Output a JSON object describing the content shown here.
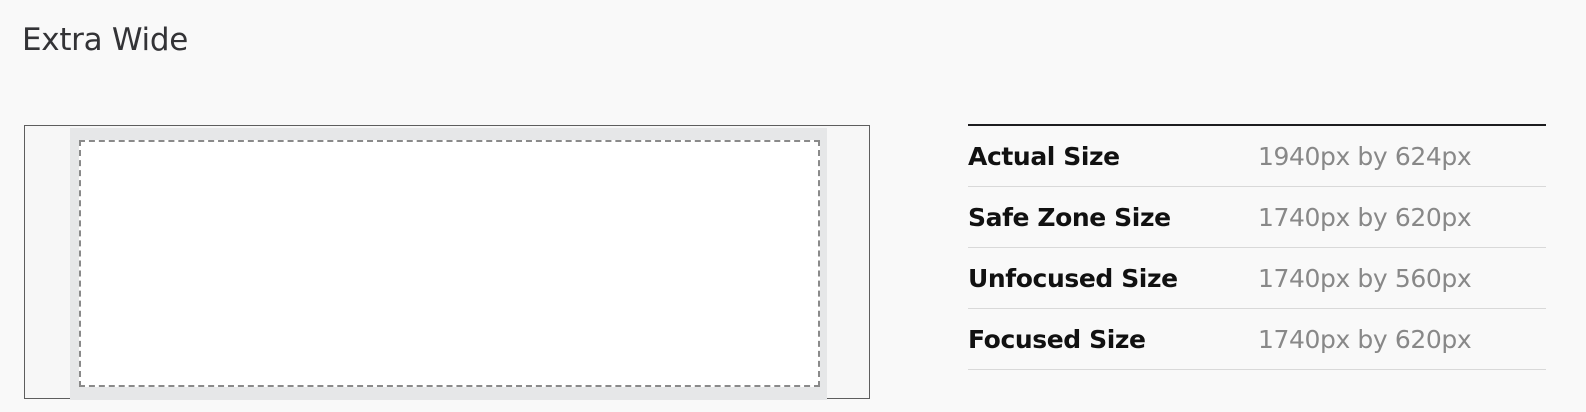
{
  "section": {
    "title": "Extra Wide"
  },
  "specs": [
    {
      "label": "Actual Size",
      "value": "1940px by 624px"
    },
    {
      "label": "Safe Zone Size",
      "value": "1740px by 620px"
    },
    {
      "label": "Unfocused Size",
      "value": "1740px by 560px"
    },
    {
      "label": "Focused Size",
      "value": "1740px by 620px"
    }
  ],
  "colors": {
    "background": "#f9f9f9",
    "focus_region": "#e6e7e8",
    "safe_zone": "#ffffff",
    "safe_zone_border": "#8a8a8a",
    "frame_border": "#5e5e5e",
    "label_text": "#111111",
    "value_text": "#888888"
  }
}
